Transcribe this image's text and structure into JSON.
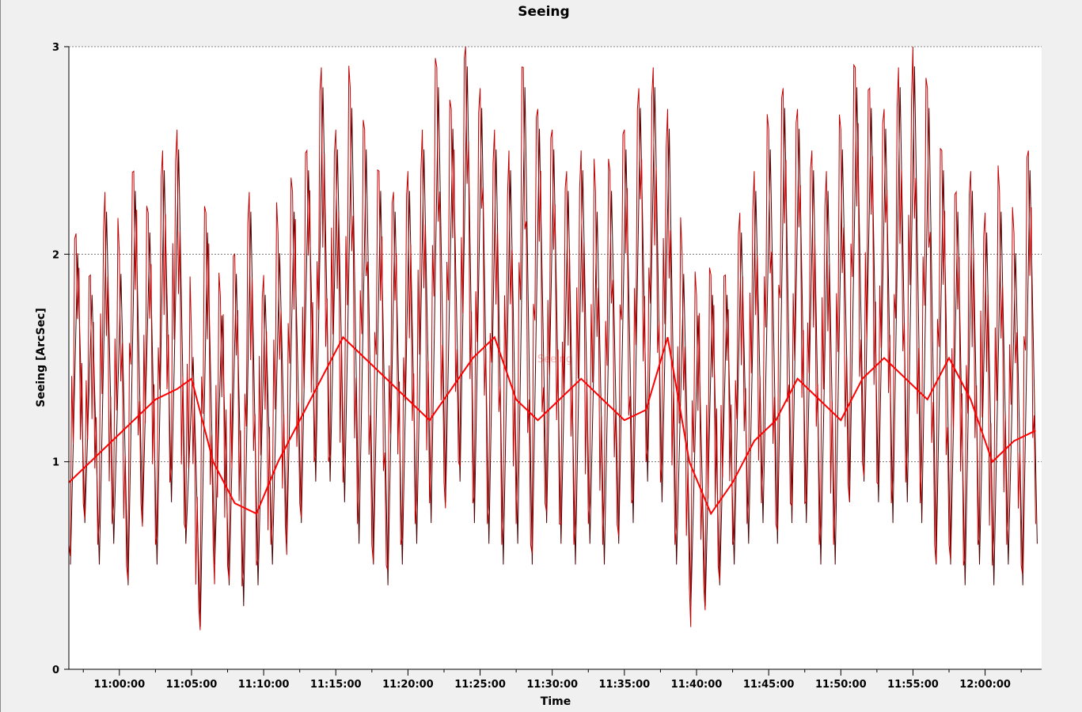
{
  "chart_data": {
    "type": "line",
    "title": "Seeing",
    "xlabel": "Time",
    "ylabel": "Seeing [ArcSec]",
    "watermark": "Seeing",
    "xlim": [
      "10:56:30",
      "12:03:55"
    ],
    "ylim": [
      0,
      3
    ],
    "y_ticks": [
      0,
      1,
      2,
      3
    ],
    "x_ticks": [
      "11:00:00",
      "11:05:00",
      "11:10:00",
      "11:15:00",
      "11:20:00",
      "11:25:00",
      "11:30:00",
      "11:35:00",
      "11:40:00",
      "11:45:00",
      "11:50:00",
      "11:55:00",
      "12:00:00"
    ],
    "grid": {
      "horizontal": true,
      "vertical": false,
      "style": "dotted"
    },
    "colors": {
      "raw": "#c00000",
      "raw_dark": "#4a0000",
      "smoothed": "#ff0000",
      "grid": "#606060",
      "plot_background": "#ffffff",
      "window_background": "#f0f0f0"
    },
    "series": [
      {
        "style": "raw",
        "x": [
          "10:56:30",
          "10:57:00",
          "10:57:30",
          "10:58:00",
          "10:58:30",
          "10:59:00",
          "10:59:30",
          "11:00:00",
          "11:00:30",
          "11:01:00",
          "11:01:30",
          "11:02:00",
          "11:02:30",
          "11:03:00",
          "11:03:30",
          "11:04:00",
          "11:04:30",
          "11:05:00",
          "11:05:30",
          "11:06:00",
          "11:06:30",
          "11:07:00",
          "11:07:30",
          "11:08:00",
          "11:08:30",
          "11:09:00",
          "11:09:30",
          "11:10:00",
          "11:10:30",
          "11:11:00",
          "11:11:30",
          "11:12:00",
          "11:12:30",
          "11:13:00",
          "11:13:30",
          "11:14:00",
          "11:14:30",
          "11:15:00",
          "11:15:30",
          "11:16:00",
          "11:16:30",
          "11:17:00",
          "11:17:30",
          "11:18:00",
          "11:18:30",
          "11:19:00",
          "11:19:30",
          "11:20:00",
          "11:20:30",
          "11:21:00",
          "11:21:30",
          "11:22:00",
          "11:22:30",
          "11:23:00",
          "11:23:30",
          "11:24:00",
          "11:24:30",
          "11:25:00",
          "11:25:30",
          "11:26:00",
          "11:26:30",
          "11:27:00",
          "11:27:30",
          "11:28:00",
          "11:28:30",
          "11:29:00",
          "11:29:30",
          "11:30:00",
          "11:30:30",
          "11:31:00",
          "11:31:30",
          "11:32:00",
          "11:32:30",
          "11:33:00",
          "11:33:30",
          "11:34:00",
          "11:34:30",
          "11:35:00",
          "11:35:30",
          "11:36:00",
          "11:36:30",
          "11:37:00",
          "11:37:30",
          "11:38:00",
          "11:38:30",
          "11:39:00",
          "11:39:30",
          "11:40:00",
          "11:40:30",
          "11:41:00",
          "11:41:30",
          "11:42:00",
          "11:42:30",
          "11:43:00",
          "11:43:30",
          "11:44:00",
          "11:44:30",
          "11:45:00",
          "11:45:30",
          "11:46:00",
          "11:46:30",
          "11:47:00",
          "11:47:30",
          "11:48:00",
          "11:48:30",
          "11:49:00",
          "11:49:30",
          "11:50:00",
          "11:50:30",
          "11:51:00",
          "11:51:30",
          "11:52:00",
          "11:52:30",
          "11:53:00",
          "11:53:30",
          "11:54:00",
          "11:54:30",
          "11:55:00",
          "11:55:30",
          "11:56:00",
          "11:56:30",
          "11:57:00",
          "11:57:30",
          "11:58:00",
          "11:58:30",
          "11:59:00",
          "11:59:30",
          "12:00:00",
          "12:00:30",
          "12:01:00",
          "12:01:30",
          "12:02:00",
          "12:02:30",
          "12:03:00",
          "12:03:30"
        ],
        "y": [
          0.6,
          2.1,
          0.8,
          1.9,
          0.6,
          2.3,
          0.7,
          2.0,
          0.5,
          2.4,
          0.8,
          2.2,
          0.6,
          2.5,
          0.9,
          2.6,
          0.7,
          1.6,
          0.3,
          2.2,
          0.6,
          1.8,
          0.5,
          2.0,
          0.4,
          2.3,
          0.5,
          1.9,
          0.6,
          2.1,
          0.7,
          2.3,
          0.8,
          2.5,
          1.0,
          2.9,
          1.0,
          2.6,
          0.9,
          2.8,
          0.7,
          2.6,
          0.6,
          2.4,
          0.5,
          2.3,
          0.6,
          2.4,
          0.7,
          2.6,
          0.8,
          2.9,
          0.9,
          2.7,
          1.0,
          3.0,
          0.8,
          2.8,
          0.7,
          2.6,
          0.6,
          2.5,
          0.7,
          2.9,
          0.6,
          2.7,
          0.8,
          2.6,
          0.7,
          2.4,
          0.6,
          2.5,
          0.7,
          2.3,
          0.6,
          2.4,
          0.7,
          2.6,
          0.8,
          2.8,
          1.0,
          2.9,
          0.9,
          2.7,
          0.6,
          2.0,
          0.4,
          1.8,
          0.4,
          1.9,
          0.5,
          1.9,
          0.6,
          2.2,
          0.7,
          2.4,
          0.8,
          2.6,
          0.7,
          2.8,
          0.8,
          2.7,
          0.8,
          2.5,
          0.6,
          2.4,
          0.6,
          2.6,
          0.9,
          2.9,
          1.0,
          2.8,
          0.9,
          2.7,
          0.8,
          2.9,
          0.9,
          3.0,
          0.8,
          2.8,
          0.6,
          2.5,
          0.6,
          2.3,
          0.5,
          2.4,
          0.6,
          2.2,
          0.5,
          2.3,
          0.6,
          2.1,
          0.5,
          2.5,
          0.7
        ]
      },
      {
        "style": "smoothed",
        "x": [
          "10:56:30",
          "10:58:00",
          "10:59:30",
          "11:01:00",
          "11:02:30",
          "11:04:00",
          "11:05:00",
          "11:06:30",
          "11:08:00",
          "11:09:30",
          "11:11:00",
          "11:12:30",
          "11:14:00",
          "11:15:30",
          "11:17:00",
          "11:18:30",
          "11:20:00",
          "11:21:30",
          "11:23:00",
          "11:24:30",
          "11:26:00",
          "11:27:30",
          "11:29:00",
          "11:30:30",
          "11:32:00",
          "11:33:30",
          "11:35:00",
          "11:36:30",
          "11:38:00",
          "11:39:30",
          "11:41:00",
          "11:42:30",
          "11:44:00",
          "11:45:30",
          "11:47:00",
          "11:48:30",
          "11:50:00",
          "11:51:30",
          "11:53:00",
          "11:54:30",
          "11:56:00",
          "11:57:30",
          "11:59:00",
          "12:00:30",
          "12:02:00",
          "12:03:30"
        ],
        "y": [
          0.9,
          1.0,
          1.1,
          1.2,
          1.3,
          1.35,
          1.4,
          1.0,
          0.8,
          0.75,
          1.0,
          1.2,
          1.4,
          1.6,
          1.5,
          1.4,
          1.3,
          1.2,
          1.35,
          1.5,
          1.6,
          1.3,
          1.2,
          1.3,
          1.4,
          1.3,
          1.2,
          1.25,
          1.6,
          1.0,
          0.75,
          0.9,
          1.1,
          1.2,
          1.4,
          1.3,
          1.2,
          1.4,
          1.5,
          1.4,
          1.3,
          1.5,
          1.3,
          1.0,
          1.1,
          1.15
        ]
      }
    ]
  }
}
